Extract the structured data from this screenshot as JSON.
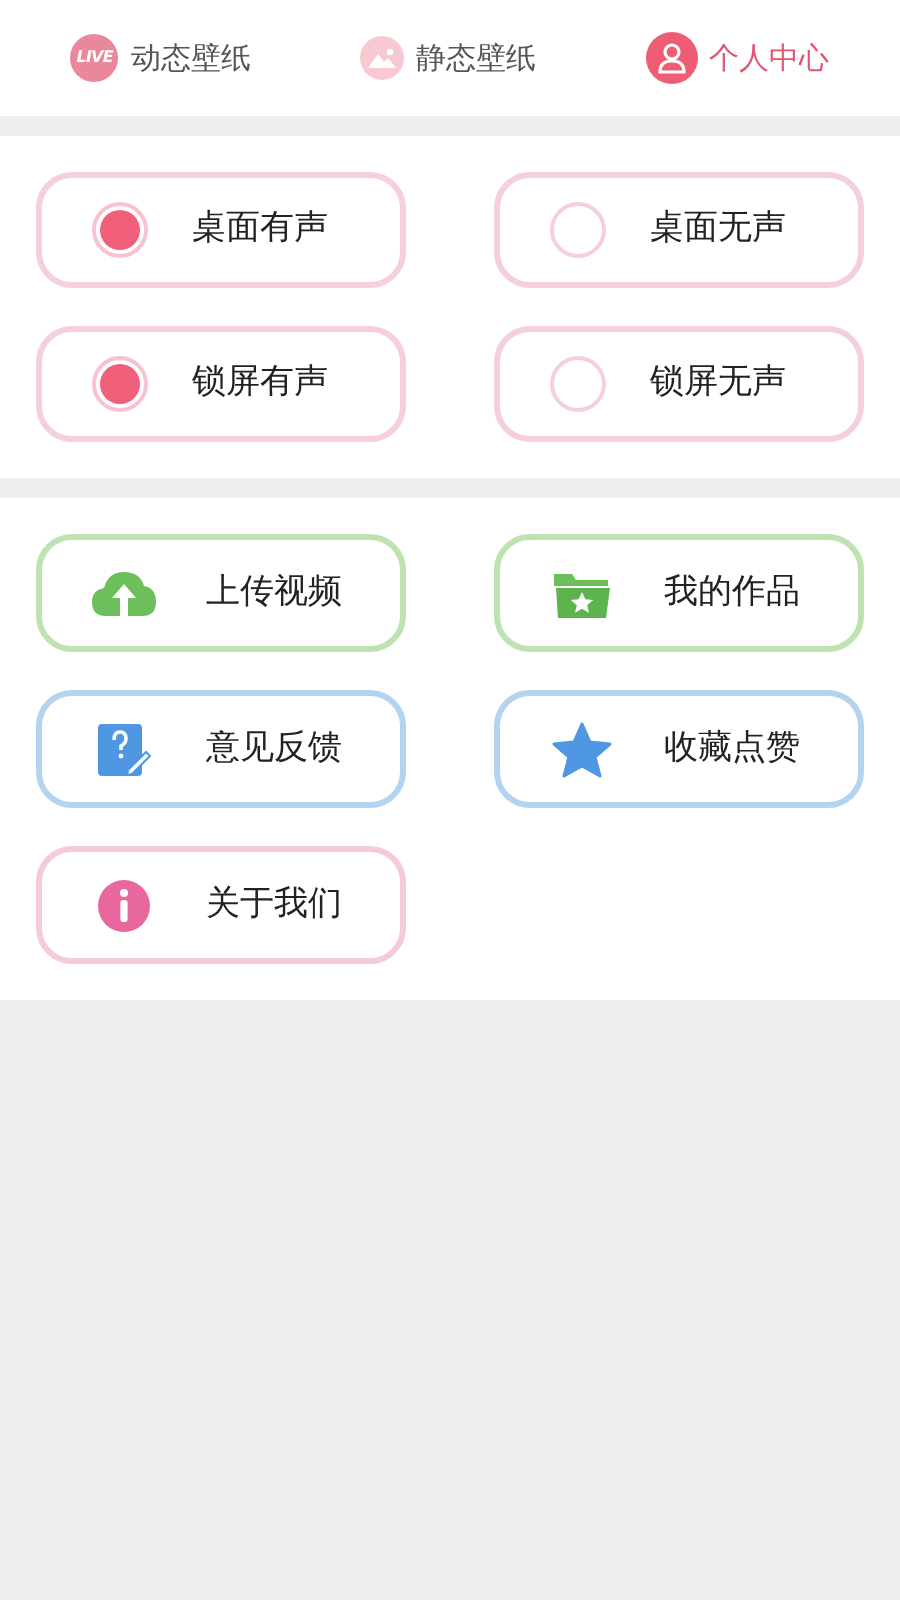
{
  "tabs": [
    {
      "kind": "live",
      "label": "动态壁纸",
      "icon_text": "LIVE",
      "selected": false
    },
    {
      "kind": "picture",
      "label": "静态壁纸",
      "selected": false
    },
    {
      "kind": "profile",
      "label": "个人中心",
      "selected": true
    }
  ],
  "sound_options": [
    {
      "label": "桌面有声",
      "selected": true
    },
    {
      "label": "桌面无声",
      "selected": false
    },
    {
      "label": "锁屏有声",
      "selected": true
    },
    {
      "label": "锁屏无声",
      "selected": false
    }
  ],
  "menu": [
    {
      "kind": "upload",
      "label": "上传视频",
      "color": "#bfe3b0"
    },
    {
      "kind": "works",
      "label": "我的作品",
      "color": "#bfe3b0"
    },
    {
      "kind": "feedback",
      "label": "意见反馈",
      "color": "#b3d4f0"
    },
    {
      "kind": "favorite",
      "label": "收藏点赞",
      "color": "#b3d4f0"
    },
    {
      "kind": "about",
      "label": "关于我们",
      "color": "#f5ccd6"
    }
  ]
}
